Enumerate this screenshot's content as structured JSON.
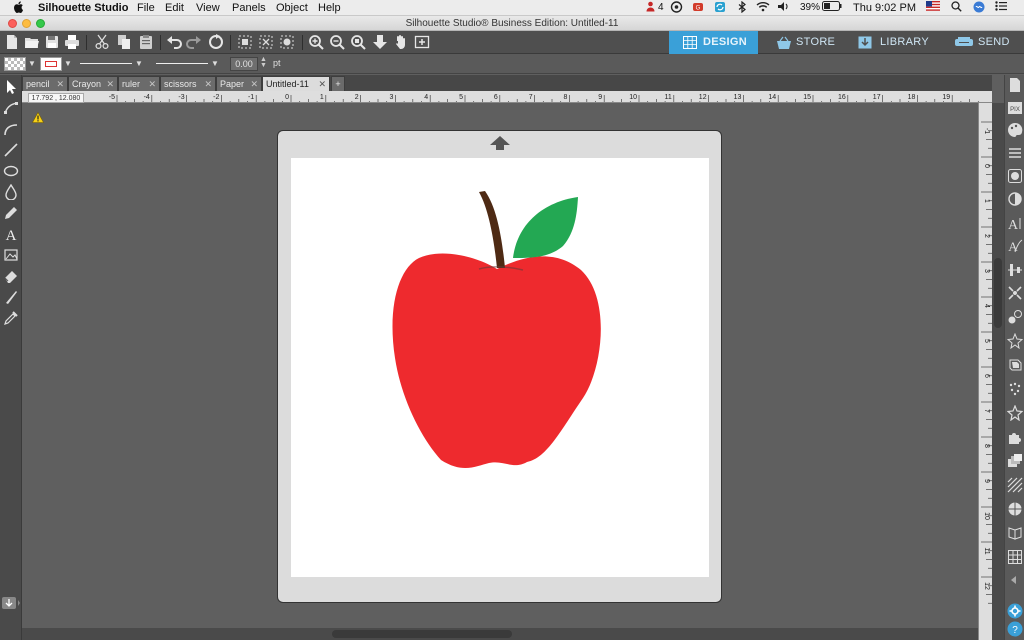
{
  "menubar": {
    "app_name": "Silhouette Studio",
    "menus": [
      "File",
      "Edit",
      "View",
      "Panels",
      "Object",
      "Help"
    ],
    "notification_count": "4",
    "battery": "39%",
    "clock": "Thu 9:02 PM"
  },
  "window": {
    "title": "Silhouette Studio® Business Edition: Untitled-11"
  },
  "nav_tabs": [
    {
      "label": "DESIGN",
      "active": true
    },
    {
      "label": "STORE",
      "active": false
    },
    {
      "label": "LIBRARY",
      "active": false
    },
    {
      "label": "SEND",
      "active": false
    }
  ],
  "properties": {
    "line_width_value": "0.00",
    "line_width_unit": "pt"
  },
  "doc_tabs": [
    {
      "label": "pencil",
      "active": false
    },
    {
      "label": "Crayon",
      "active": false
    },
    {
      "label": "ruler",
      "active": false
    },
    {
      "label": "scissors",
      "active": false
    },
    {
      "label": "Paper",
      "active": false
    },
    {
      "label": "Untitled-11",
      "active": true
    }
  ],
  "add_tab_label": "+",
  "coordinates": "17.792 , 12.080",
  "hruler_ticks": [
    "-5",
    "-4",
    "-3",
    "-2",
    "-1",
    "0",
    "1",
    "2",
    "3",
    "4",
    "5",
    "6",
    "7",
    "8",
    "9",
    "10",
    "11",
    "12",
    "13",
    "14",
    "15",
    "16",
    "17",
    "18",
    "19"
  ],
  "vruler_ticks": [
    "-1",
    "0",
    "1",
    "2",
    "3",
    "4",
    "5",
    "6",
    "7",
    "8",
    "9",
    "10",
    "11",
    "12"
  ],
  "colors": {
    "accent": "#3aa0d8",
    "apple_red": "#ee2a2e",
    "leaf_green": "#23a853",
    "stem_brown": "#4e2a14"
  }
}
